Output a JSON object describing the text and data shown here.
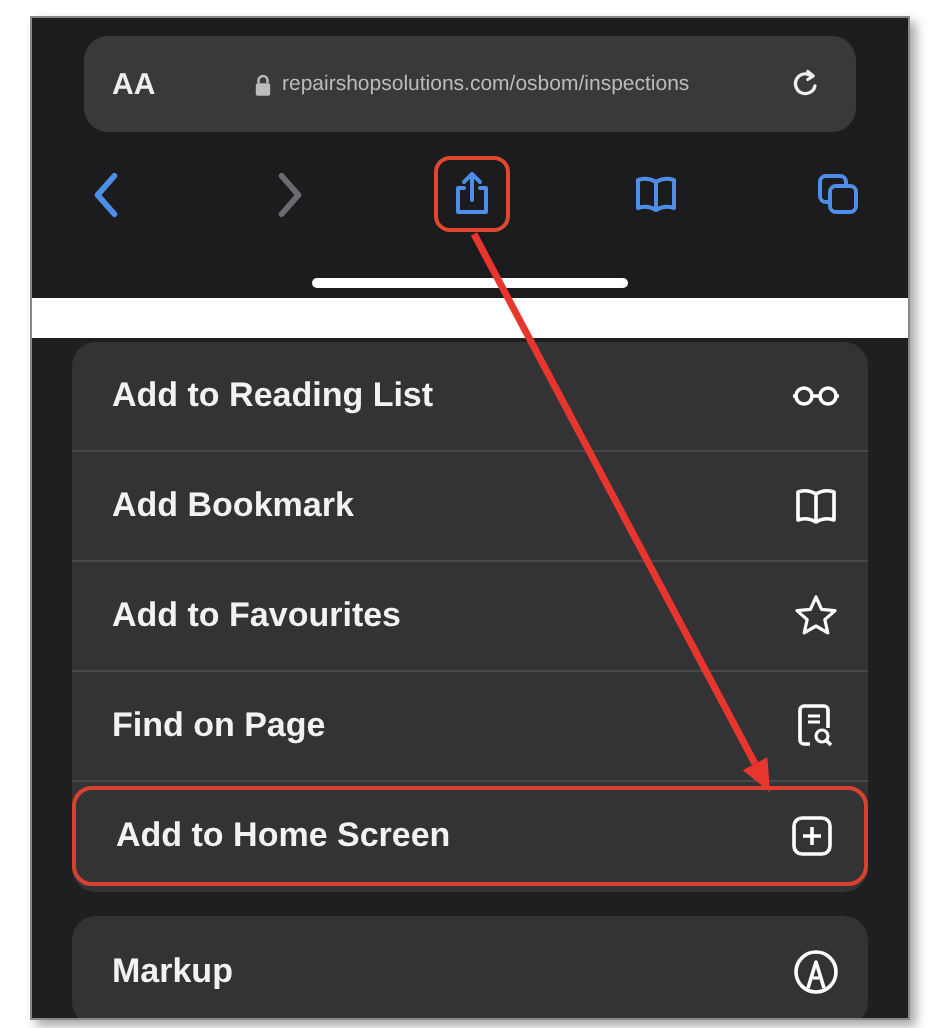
{
  "address_bar": {
    "text_size_label": "AA",
    "url": "repairshopsolutions.com/osbom/inspections"
  },
  "toolbar": [
    {
      "disabled": false,
      "highlighted": false
    },
    {
      "disabled": true,
      "highlighted": false
    },
    {
      "disabled": false,
      "highlighted": true
    },
    {
      "disabled": false,
      "highlighted": false
    },
    {
      "disabled": false,
      "highlighted": false
    }
  ],
  "menu_sections": [
    {
      "items": [
        {
          "label": "Add to Reading List",
          "highlighted": false
        },
        {
          "label": "Add Bookmark",
          "highlighted": false
        },
        {
          "label": "Add to Favourites",
          "highlighted": false
        },
        {
          "label": "Find on Page",
          "highlighted": false
        },
        {
          "label": "Add to Home Screen",
          "highlighted": true
        }
      ]
    },
    {
      "items": [
        {
          "label": "Markup",
          "highlighted": false
        }
      ]
    }
  ]
}
